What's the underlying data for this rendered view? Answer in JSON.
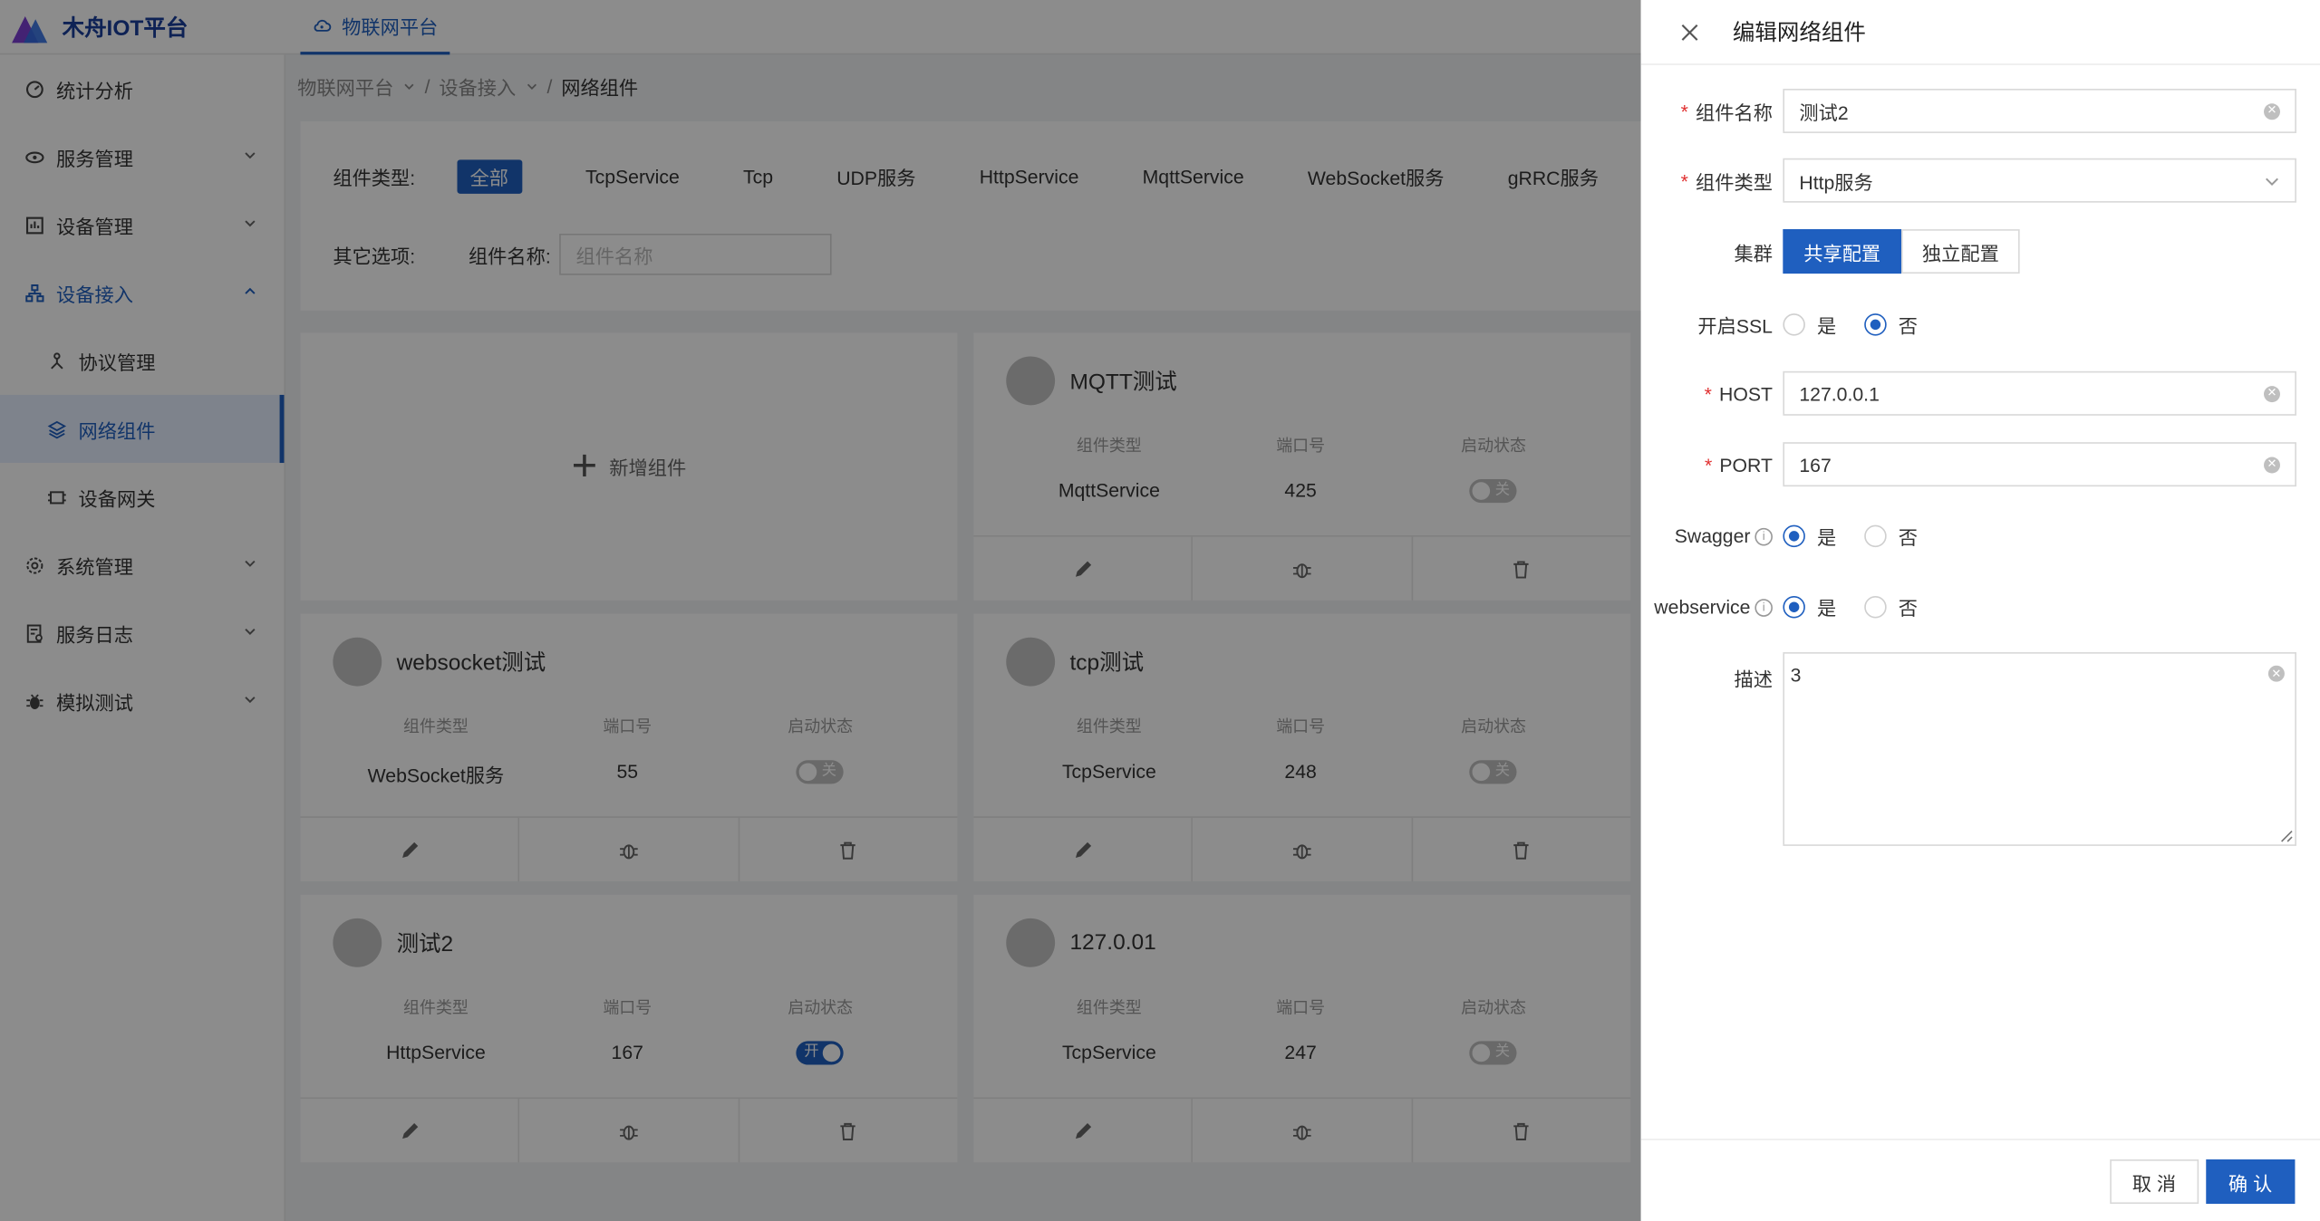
{
  "app": {
    "title": "木舟IOT平台",
    "top_tab": "物联网平台"
  },
  "sidebar": {
    "items": [
      {
        "label": "统计分析",
        "icon": "dashboard-icon",
        "level": 1,
        "expandable": false
      },
      {
        "label": "服务管理",
        "icon": "service-icon",
        "level": 1,
        "expandable": true,
        "open": false
      },
      {
        "label": "设备管理",
        "icon": "device-icon",
        "level": 1,
        "expandable": true,
        "open": false
      },
      {
        "label": "设备接入",
        "icon": "access-icon",
        "level": 1,
        "expandable": true,
        "open": true
      },
      {
        "label": "协议管理",
        "icon": "protocol-icon",
        "level": 2
      },
      {
        "label": "网络组件",
        "icon": "network-icon",
        "level": 2,
        "selected": true
      },
      {
        "label": "设备网关",
        "icon": "gateway-icon",
        "level": 2
      },
      {
        "label": "系统管理",
        "icon": "settings-icon",
        "level": 1,
        "expandable": true,
        "open": false
      },
      {
        "label": "服务日志",
        "icon": "log-icon",
        "level": 1,
        "expandable": true,
        "open": false
      },
      {
        "label": "模拟测试",
        "icon": "bug-icon",
        "level": 1,
        "expandable": true,
        "open": false
      }
    ]
  },
  "breadcrumb": [
    "物联网平台",
    "设备接入",
    "网络组件"
  ],
  "filter": {
    "type_label": "组件类型:",
    "types": [
      "全部",
      "TcpService",
      "Tcp",
      "UDP服务",
      "HttpService",
      "MqttService",
      "WebSocket服务",
      "gRRC服务"
    ],
    "active_type": "全部",
    "other_label": "其它选项:",
    "name_label": "组件名称:",
    "name_placeholder": "组件名称"
  },
  "add_card": {
    "label": "新增组件"
  },
  "card_labels": {
    "type": "组件类型",
    "port": "端口号",
    "status": "启动状态",
    "on": "开",
    "off": "关"
  },
  "cards": [
    {
      "name": "MQTT测试",
      "type": "MqttService",
      "port": "425",
      "enabled": false
    },
    {
      "name": "websocket测试",
      "type": "WebSocket服务",
      "port": "55",
      "enabled": false
    },
    {
      "name": "tcp测试",
      "type": "TcpService",
      "port": "248",
      "enabled": false
    },
    {
      "name": "测试2",
      "type": "HttpService",
      "port": "167",
      "enabled": true
    },
    {
      "name": "127.0.01",
      "type": "TcpService",
      "port": "247",
      "enabled": false
    }
  ],
  "drawer": {
    "title": "编辑网络组件",
    "fields": {
      "name": {
        "label": "组件名称",
        "value": "测试2"
      },
      "type": {
        "label": "组件类型",
        "value": "Http服务"
      },
      "cluster": {
        "label": "集群",
        "options": [
          "共享配置",
          "独立配置"
        ],
        "selected": "共享配置"
      },
      "ssl": {
        "label": "开启SSL",
        "options": [
          "是",
          "否"
        ],
        "selected": "否"
      },
      "host": {
        "label": "HOST",
        "value": "127.0.0.1"
      },
      "port": {
        "label": "PORT",
        "value": "167"
      },
      "swagger": {
        "label": "Swagger",
        "options": [
          "是",
          "否"
        ],
        "selected": "是"
      },
      "webservice": {
        "label": "webservice",
        "options": [
          "是",
          "否"
        ],
        "selected": "是"
      },
      "desc": {
        "label": "描述",
        "value": "3"
      }
    },
    "cancel_label": "取 消",
    "ok_label": "确 认"
  },
  "colors": {
    "primary": "#1f5fbf",
    "mask": "rgba(0,0,0,0.45)"
  }
}
